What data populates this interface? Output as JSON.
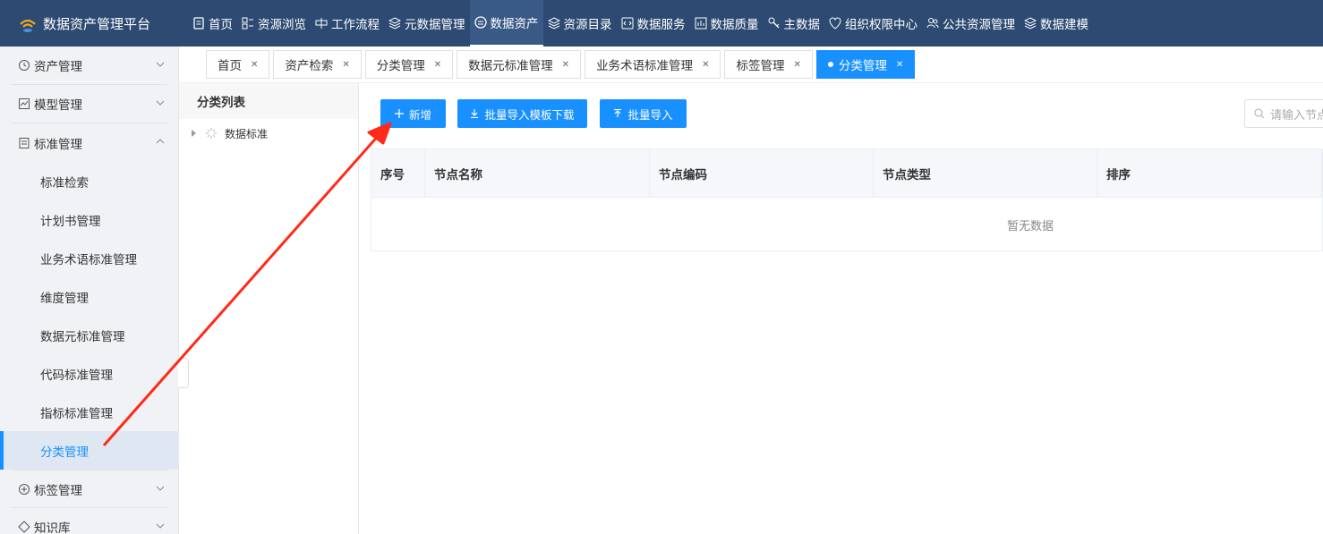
{
  "app": {
    "title": "数据资产管理平台"
  },
  "nav": {
    "items": [
      {
        "label": "首页",
        "icon": "document-icon"
      },
      {
        "label": "资源浏览",
        "icon": "grid-icon"
      },
      {
        "label": "工作流程",
        "icon": "workflow-icon"
      },
      {
        "label": "元数据管理",
        "icon": "layers-icon"
      },
      {
        "label": "数据资产",
        "icon": "database-icon",
        "active": true
      },
      {
        "label": "资源目录",
        "icon": "layers-icon"
      },
      {
        "label": "数据服务",
        "icon": "code-icon"
      },
      {
        "label": "数据质量",
        "icon": "chart-icon"
      },
      {
        "label": "主数据",
        "icon": "key-icon"
      },
      {
        "label": "组织权限中心",
        "icon": "shield-icon"
      },
      {
        "label": "公共资源管理",
        "icon": "users-icon"
      },
      {
        "label": "数据建模",
        "icon": "layers-icon"
      }
    ]
  },
  "sidebar": {
    "groups": [
      {
        "label": "资产管理",
        "icon": "clock-icon",
        "expanded": false
      },
      {
        "label": "模型管理",
        "icon": "chart-icon",
        "expanded": false
      },
      {
        "label": "标准管理",
        "icon": "document-icon",
        "expanded": true
      }
    ],
    "sub_items": [
      "标准检索",
      "计划书管理",
      "业务术语标准管理",
      "维度管理",
      "数据元标准管理",
      "代码标准管理",
      "指标标准管理",
      "分类管理"
    ],
    "active_sub": "分类管理",
    "after_groups": [
      {
        "label": "标签管理",
        "icon": "plus-circle-icon"
      },
      {
        "label": "知识库",
        "icon": "tag-icon"
      }
    ]
  },
  "tabs": [
    {
      "label": "首页"
    },
    {
      "label": "资产检索"
    },
    {
      "label": "分类管理"
    },
    {
      "label": "数据元标准管理"
    },
    {
      "label": "业务术语标准管理"
    },
    {
      "label": "标签管理"
    },
    {
      "label": "分类管理",
      "active": true
    }
  ],
  "tree": {
    "title": "分类列表",
    "root": "数据标准"
  },
  "toolbar": {
    "add": "新增",
    "template_download": "批量导入模板下载",
    "batch_import": "批量导入"
  },
  "search": {
    "placeholder": "请输入节点"
  },
  "table": {
    "columns": [
      "序号",
      "节点名称",
      "节点编码",
      "节点类型",
      "排序"
    ],
    "empty_text": "暂无数据"
  },
  "colors": {
    "primary": "#1890ff",
    "header_bg": "#2d4a72",
    "arrow": "#ff2a1a"
  }
}
